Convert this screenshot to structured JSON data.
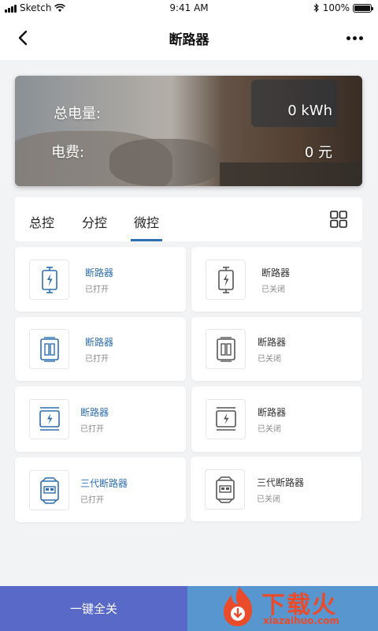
{
  "status_bar": {
    "carrier": "Sketch",
    "time": "9:41 AM",
    "battery": "100%",
    "battery_level": 1.0
  },
  "nav": {
    "title": "断路器"
  },
  "banner": {
    "total_power_label": "总电量:",
    "total_power_value": "0 kWh",
    "fee_label": "电费:",
    "fee_value": "0 元"
  },
  "tabs": [
    {
      "label": "总控"
    },
    {
      "label": "分控"
    },
    {
      "label": "微控",
      "active": true
    }
  ],
  "devices": [
    {
      "name": "断路器",
      "status": "已打开"
    },
    {
      "name": "断路器",
      "status": "已关闭"
    },
    {
      "name": "断路器",
      "status": "已打开"
    },
    {
      "name": "断路器",
      "status": "已关闭"
    },
    {
      "name": "断路器",
      "status": "已打开"
    },
    {
      "name": "断路器",
      "status": "已关闭"
    },
    {
      "name": "三代断路器",
      "status": "已打开"
    },
    {
      "name": "三代断路器",
      "status": "已关闭"
    }
  ],
  "bottom": {
    "all_off_label": "一键全关"
  },
  "watermark": {
    "text": "下载火",
    "url": "xiazaihuo.com"
  },
  "colors": {
    "accent_blue": "#2d6fb0",
    "bottom_left": "#5969c8",
    "bottom_right": "#5796cf",
    "watermark": "#ea4b2b"
  }
}
